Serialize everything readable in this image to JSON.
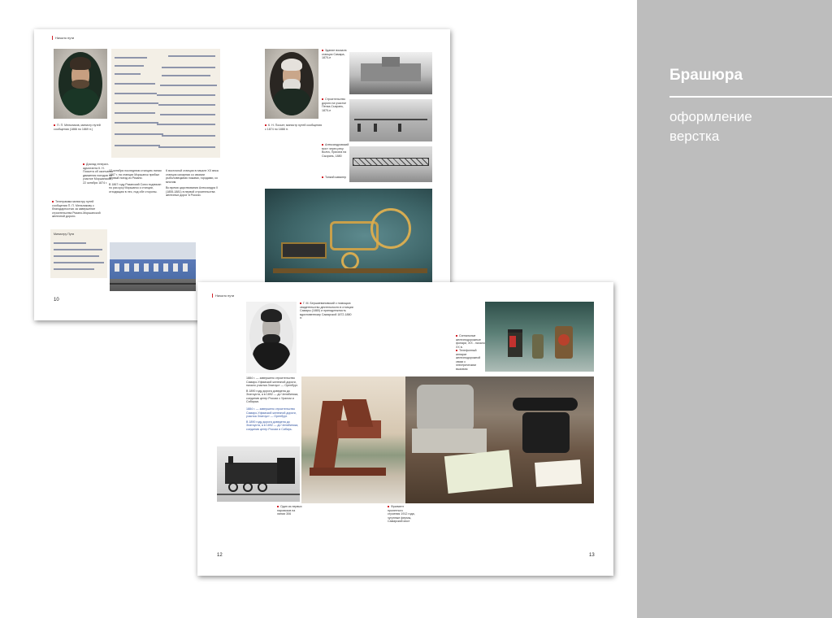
{
  "sidebar": {
    "title": "Брашюра",
    "subtitle_line1": "оформление",
    "subtitle_line2": "верстка"
  },
  "spread_a": {
    "section": "Начало пути",
    "page_left": "10",
    "caption_portrait1": "П. П. Мельников, министр путей сообщения (1866 по 1869 гг.)",
    "caption_document": "Доклад генерал-адъютанта К. Н. Посьета об окончании движения поездов на участке Моршанской, 22 октября 1874 г.",
    "caption_telegram": "Телеграмма министру путей сообщения П. П. Мельникову с благодарностью за завершение строительства Рязано-Моршанской железной дороги.",
    "caption_portrait2": "К. Н. Посьет, министр путей сообщения с 1874 по 1888 гг.",
    "caption_photo1": "Здание вокзала станции Самара, 1870-е",
    "caption_photo2": "Строительство дороги на участке Пенза-Сызрань, 1870-е",
    "caption_photo3": "Александровский мост через реку Волга, Присяга на Сызрань, 1880",
    "caption_photo4": "Тонкий кавалер",
    "body_col1_a": "12 октября последнюю станцию линии 1867 г. на станции Моршанск прибыл первый поезд из Рязани.",
    "body_col1_b": "В 1867 году Рязанский Союз подписан по раз кусу Моршанск к станции, отходящим в лес, под обе стороны.",
    "body_col2_a": "К восточной станции в начале XX века станция сахарная со своими рыболовецкими ложами, городами, ко многим.",
    "body_col2_b": "Во время царствования Александра II (1855-1881) в первой строительства железных дорог в России.",
    "telegram_head": "Министру Пути"
  },
  "spread_b": {
    "section": "Начало пути",
    "page_left": "12",
    "page_right": "13",
    "caption_portrait": "Г. М. Бершиевановский с помощью свидетельство деятельности в станции Самары (1880) и принадлежность вдохновенному Самарской 1872-1880 гг.",
    "caption_lamps": "Сигнальные железнодорожные фонари, XIX - начало XX в.",
    "caption_telephone": "Телефонный аппарат железнодорожной связи с электрическим вызовом",
    "body_black": "1884 г. — завершено строительство Самаро-Уфимской железной дороги, начало участка Златоуст — Оренбург.",
    "body_black_2": "В 1890 году дорога доведена до Златоуста, а в 1892 — до Челябинска, соединив центр России с Уралом и Сибирью.",
    "body_blue": "1884 г. — завершено строительство Самаро-Уфимской железной дороги, участка Златоуст — Оренбург.",
    "body_blue_2": "В 1890 году дорога доведена до Златоуста, а в 1892 — до Челябинска, соединив центр России и Сибирь.",
    "caption_locomotive": "Один из первых паровозов на линии 306",
    "caption_bridge": "Фрагмент пролетного строения 1912 года, чугунные фермы, Самарский мост"
  }
}
